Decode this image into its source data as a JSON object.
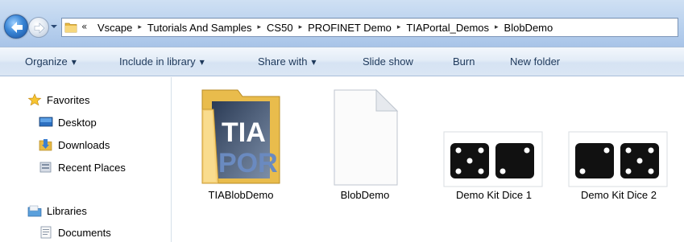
{
  "address_bar": {
    "overflow_glyph": "«",
    "breadcrumbs": [
      "Vscape",
      "Tutorials And Samples",
      "CS50",
      "PROFINET Demo",
      "TIAPortal_Demos",
      "BlobDemo"
    ],
    "separator_glyph": "▸"
  },
  "toolbar": {
    "organize": "Organize",
    "include_in_library": "Include in library",
    "share_with": "Share with",
    "slide_show": "Slide show",
    "burn": "Burn",
    "new_folder": "New folder",
    "caret": "▼"
  },
  "nav_pane": {
    "favorites": "Favorites",
    "desktop": "Desktop",
    "downloads": "Downloads",
    "recent_places": "Recent Places",
    "libraries": "Libraries",
    "documents": "Documents"
  },
  "files": [
    {
      "name": "TIABlobDemo",
      "icon": "folder-icon",
      "thumb_text_1": "TIA",
      "thumb_text_2": "POR"
    },
    {
      "name": "BlobDemo",
      "icon": "blank-file-icon"
    },
    {
      "name": "Demo Kit Dice 1",
      "icon": "dice-image-icon"
    },
    {
      "name": "Demo Kit Dice 2",
      "icon": "dice-image-icon"
    }
  ],
  "colors": {
    "toolbar_text": "#1e395b",
    "dice_body": "#111111",
    "folder_yellow": "#f4d37a",
    "selection_blue": "#3a86d6"
  }
}
